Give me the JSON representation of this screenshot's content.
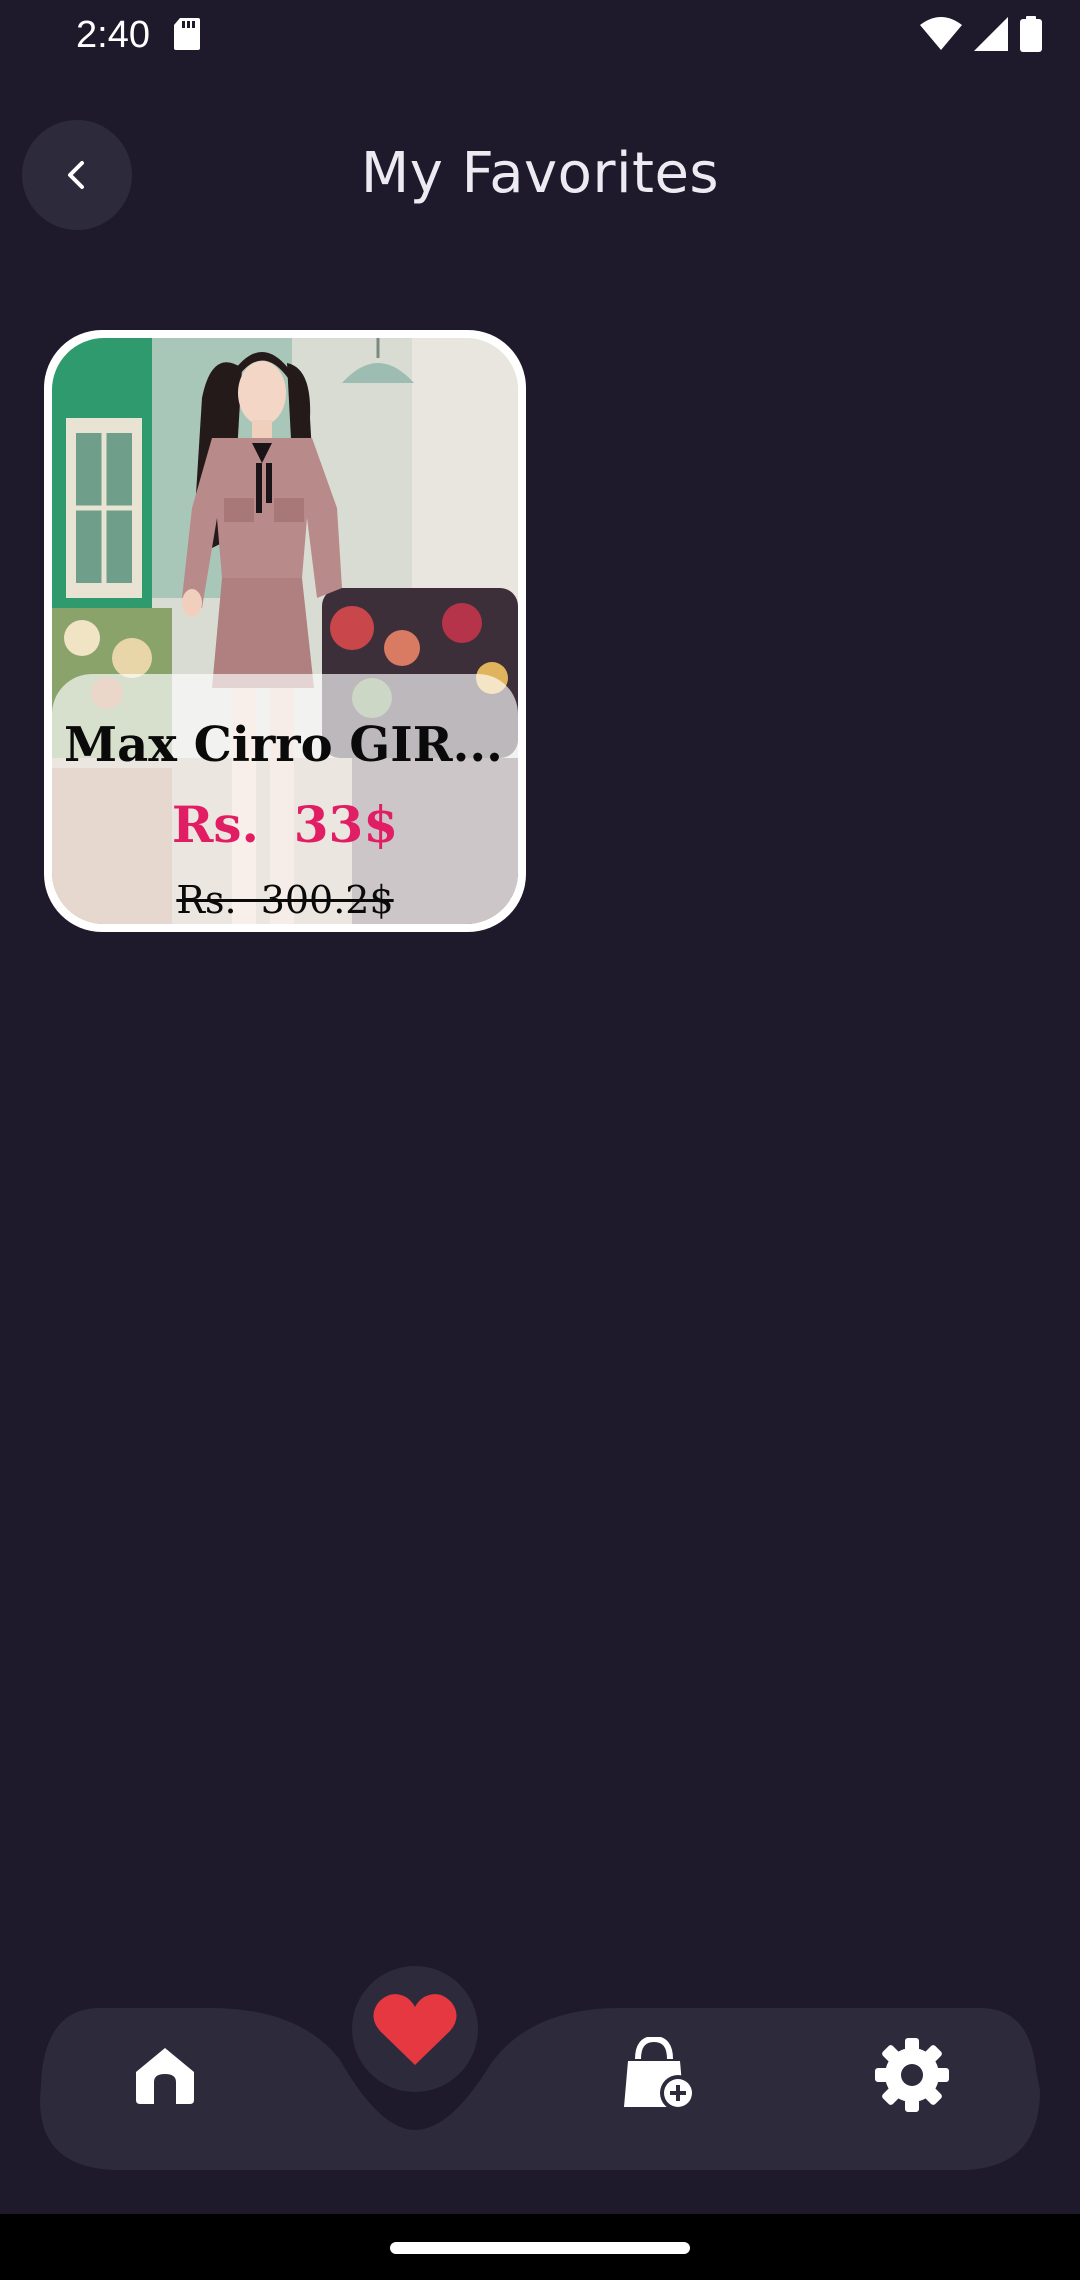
{
  "status_bar": {
    "time": "2:40",
    "icons": [
      "sd-card-icon",
      "wifi-icon",
      "cell-signal-icon",
      "battery-icon"
    ]
  },
  "header": {
    "title": "My Favorites",
    "back_icon": "chevron-left-icon"
  },
  "favorites": [
    {
      "name": "Max Cirro GIR...",
      "price": "Rs.  33$",
      "original_price": "Rs.  300.2$",
      "image": "woman in pink tweed jacket and skirt"
    }
  ],
  "bottom_nav": {
    "items": [
      {
        "icon": "home-icon",
        "active": false
      },
      {
        "icon": "heart-icon",
        "active": true
      },
      {
        "icon": "shopping-bag-add-icon",
        "active": false
      },
      {
        "icon": "gear-icon",
        "active": false
      }
    ]
  },
  "colors": {
    "background": "#1e1a2c",
    "surface": "#2d2a3b",
    "accent_red": "#e53841",
    "price_pink": "#e11d63",
    "text_light": "#ecebf1"
  }
}
